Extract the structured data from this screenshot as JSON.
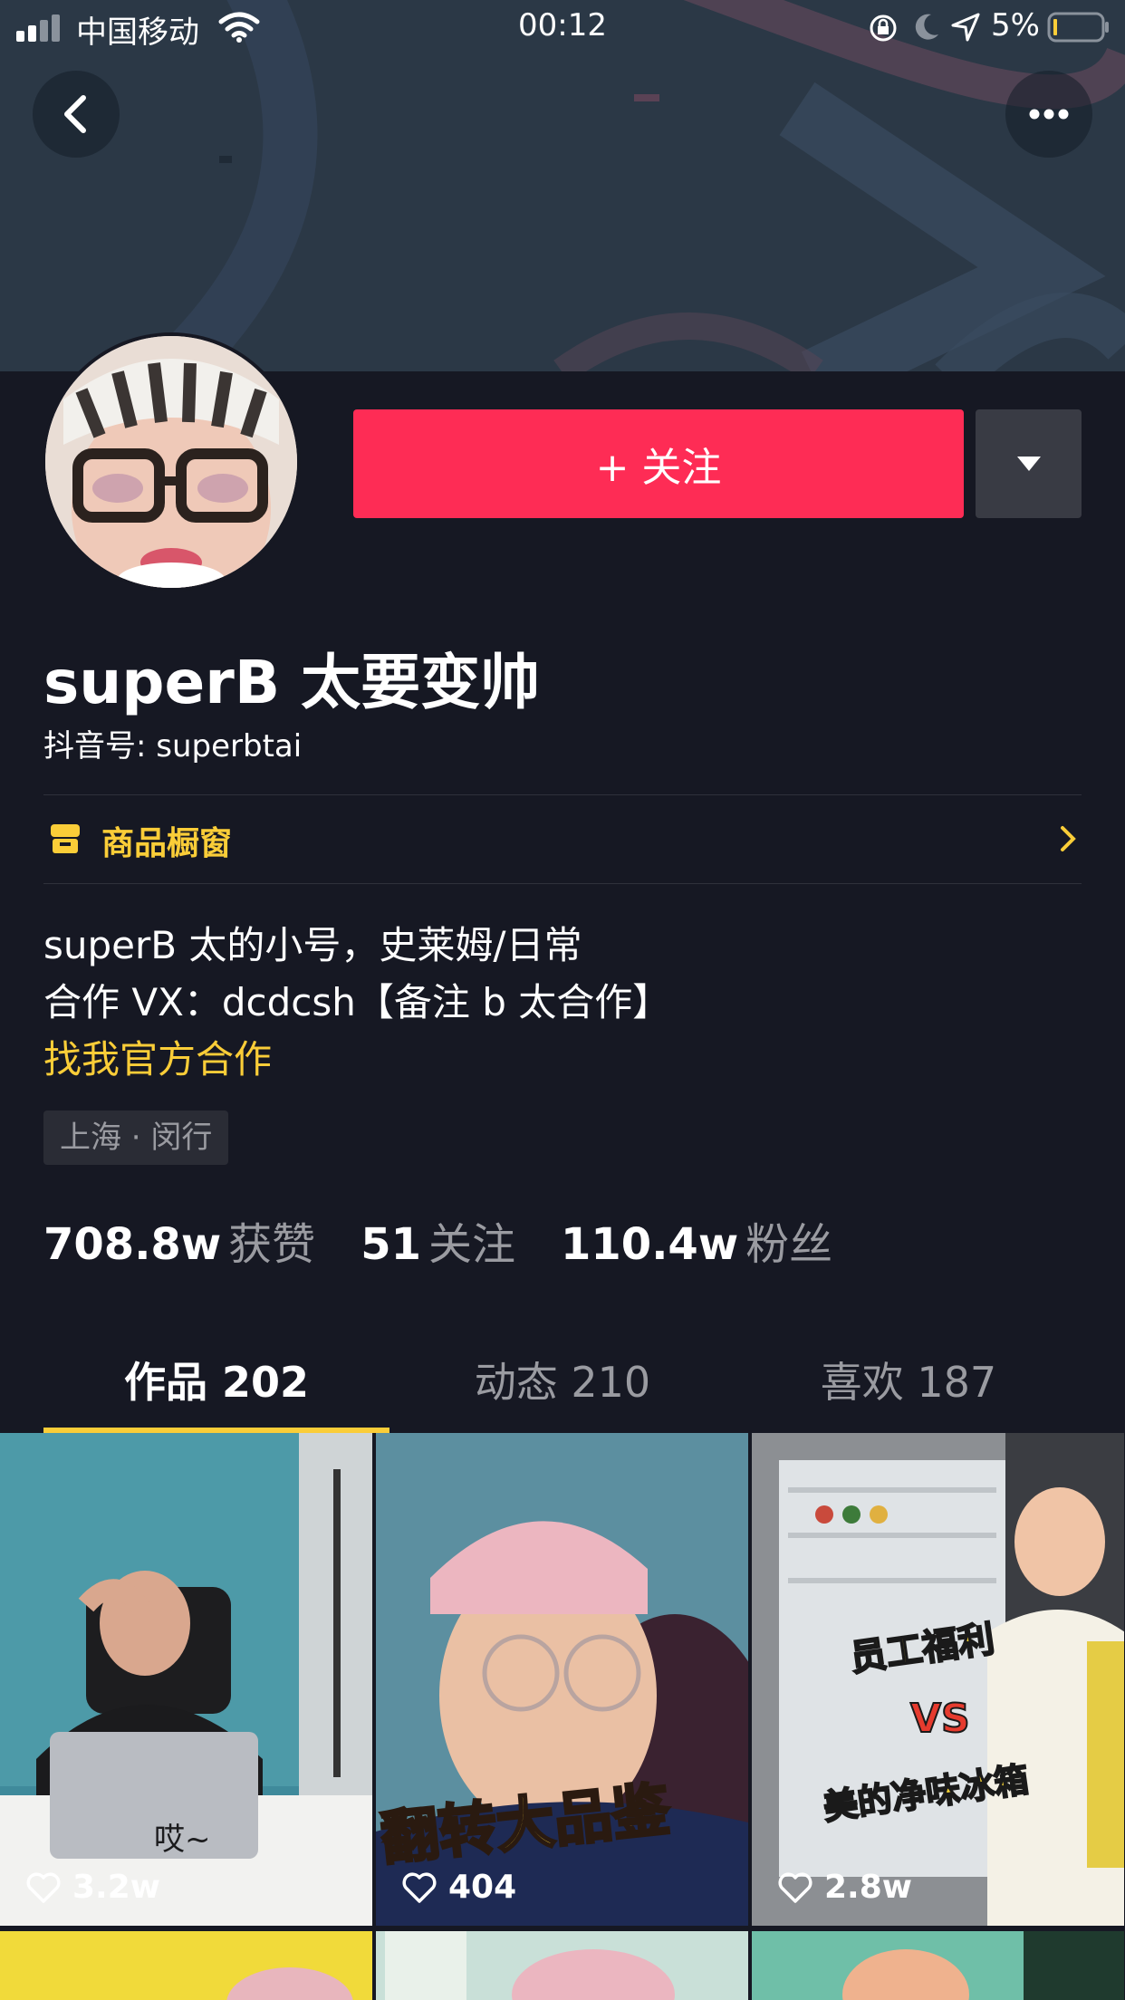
{
  "status_bar": {
    "carrier": "中国移动",
    "time": "00:12",
    "battery": "5%"
  },
  "header": {
    "back_icon": "chevron-left-icon",
    "more_icon": "ellipsis-icon"
  },
  "profile": {
    "name": "superB 太要变帅",
    "account": "抖音号: superbtai",
    "follow_label": "+ 关注",
    "shop_label": "商品橱窗",
    "bio_line1": "superB 太的小号，史莱姆/日常",
    "bio_line2": "合作 VX：dcdcsh【备注 b 太合作】",
    "bio_link": "找我官方合作",
    "location": "上海 · 闵行"
  },
  "stats": [
    {
      "num": "708.8w",
      "label": "获赞"
    },
    {
      "num": "51",
      "label": "关注"
    },
    {
      "num": "110.4w",
      "label": "粉丝"
    }
  ],
  "tabs": [
    {
      "label": "作品 202",
      "active": true
    },
    {
      "label": "动态 210",
      "active": false
    },
    {
      "label": "喜欢 187",
      "active": false
    }
  ],
  "videos": [
    {
      "likes": "3.2w",
      "caption": "哎~"
    },
    {
      "likes": "404",
      "caption": "翻转大品鉴"
    },
    {
      "likes": "2.8w",
      "caption_a": "员工福利",
      "caption_vs": "VS",
      "caption_b": "美的净味冰箱"
    }
  ],
  "colors": {
    "background": "#161823",
    "follow": "#fe2c55",
    "accent": "#facd38",
    "secondary_text": "#9a9ba1"
  }
}
